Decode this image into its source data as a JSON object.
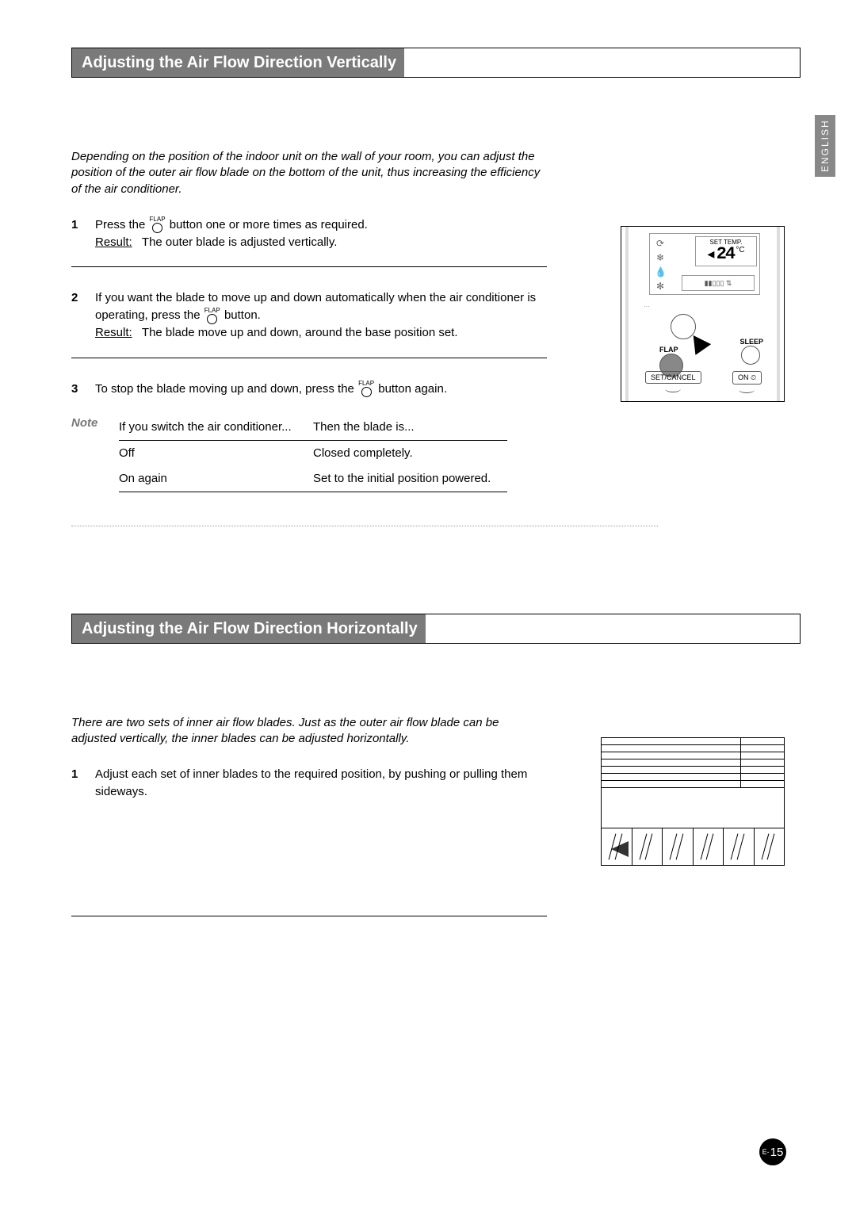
{
  "lang_tab": "ENGLISH",
  "section1": {
    "title": "Adjusting the Air Flow Direction Vertically",
    "intro": "Depending on the position of the indoor unit on the wall of your room, you can adjust the position of the outer air flow blade on the bottom of the unit, thus increasing the efficiency of the air conditioner.",
    "step1_a": "Press the ",
    "step1_b": " button one or more times as required.",
    "step1_result_label": "Result:",
    "step1_result": "The outer blade is adjusted vertically.",
    "step2_a": "If you want the blade to move up and down automatically when the air conditioner is operating, press the ",
    "step2_b": " button.",
    "step2_result_label": "Result:",
    "step2_result": "The blade move up and down, around the base position set.",
    "step3_a": "To stop the blade moving up and down, press the ",
    "step3_b": " button again.",
    "note_label": "Note",
    "note_hdr1": "If you switch the air conditioner...",
    "note_hdr2": "Then the blade is...",
    "note_r1c1": "Off",
    "note_r1c2": "Closed completely.",
    "note_r2c1": "On again",
    "note_r2c2": "Set to the initial position powered.",
    "flap_label": "FLAP"
  },
  "remote": {
    "set_temp_label": "SET TEMP.",
    "temp_value": "24",
    "temp_unit": "°C",
    "flap_label": "FLAP",
    "sleep_label": "SLEEP",
    "set_cancel": "SET/CANCEL",
    "on_label": "ON ⏲"
  },
  "section2": {
    "title": "Adjusting the Air Flow Direction Horizontally",
    "intro": "There are two sets of inner air flow blades. Just as the outer air flow blade can be adjusted vertically, the inner blades can be adjusted horizontally.",
    "step1": "Adjust each set of inner blades to the required position, by pushing or pulling them sideways."
  },
  "page_number": {
    "prefix": "E-",
    "num": "15"
  }
}
